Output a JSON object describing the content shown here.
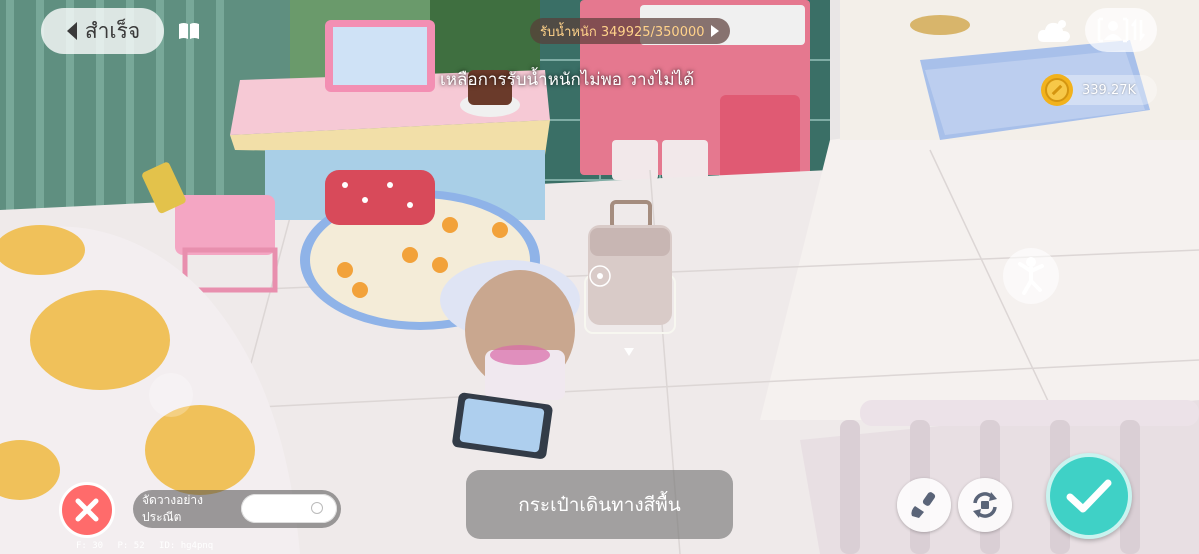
{
  "header": {
    "done_label": "สำเร็จ",
    "weight_label": "รับน้ำหนัก 349925/350000",
    "warning": "เหลือการรับน้ำหนักไม่พอ วางไม่ได้"
  },
  "currency": {
    "coins": "339.27K"
  },
  "selected_item": {
    "name": "กระเป๋าเดินทางสีพื้น"
  },
  "placement": {
    "precise_label": "จัดวางอย่างประณีต",
    "precise_enabled": false
  },
  "debug": {
    "fps": "F: 30",
    "ping": "P: 52",
    "id": "ID: hg4pnq"
  },
  "colors": {
    "confirm": "#3fd1c6",
    "cancel": "#ff6b6b",
    "weight_text": "#ffd28a"
  },
  "icons": [
    "back-arrow-icon",
    "book-icon",
    "cloud-icon",
    "avatar-swap-icon",
    "coin-icon",
    "emote-icon",
    "close-icon",
    "brush-icon",
    "rotate-icon",
    "check-icon",
    "play-icon"
  ]
}
